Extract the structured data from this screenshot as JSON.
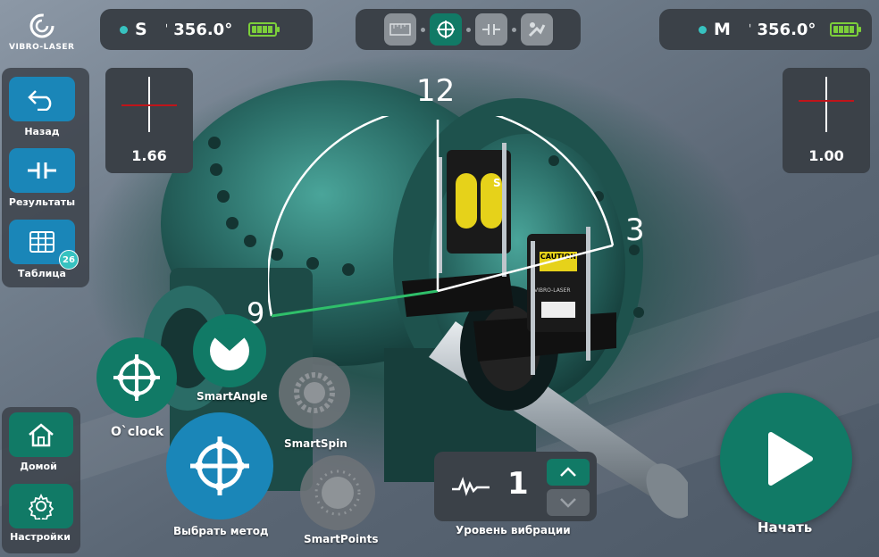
{
  "brand": {
    "name": "VIBRO-LASER"
  },
  "header": {
    "sensor_s": {
      "letter": "S",
      "angle": "356.0°"
    },
    "sensor_m": {
      "letter": "M",
      "angle": "356.0°"
    }
  },
  "colors": {
    "accent_green": "#117a66",
    "accent_blue": "#1a86b8",
    "panel": "#3b4148",
    "indicator": "#37c2c0",
    "battery": "#7ccf3a"
  },
  "mode_tabs": [
    "ruler-icon",
    "target-icon",
    "coupling-icon",
    "machine-icon"
  ],
  "sidebar": {
    "back": {
      "label": "Назад"
    },
    "results": {
      "label": "Результаты"
    },
    "table": {
      "label": "Таблица",
      "badge": "26"
    },
    "home": {
      "label": "Домой"
    },
    "settings": {
      "label": "Настройки"
    }
  },
  "offsets": {
    "left": "1.66",
    "right": "1.00"
  },
  "clock_labels": {
    "twelve": "12",
    "three": "3",
    "nine": "9"
  },
  "methods": {
    "oclock": "O`clock",
    "smartangle": "SmartAngle",
    "smartspin": "SmartSpin",
    "smartpoints": "SmartPoints",
    "choose": "Выбрать метод"
  },
  "vibration": {
    "value": "1",
    "label": "Уровень вибрации"
  },
  "start": {
    "label": "Начать"
  },
  "device_labels": {
    "s": "S",
    "caution": "CAUTION",
    "brand": "VIBRO-LASER"
  }
}
